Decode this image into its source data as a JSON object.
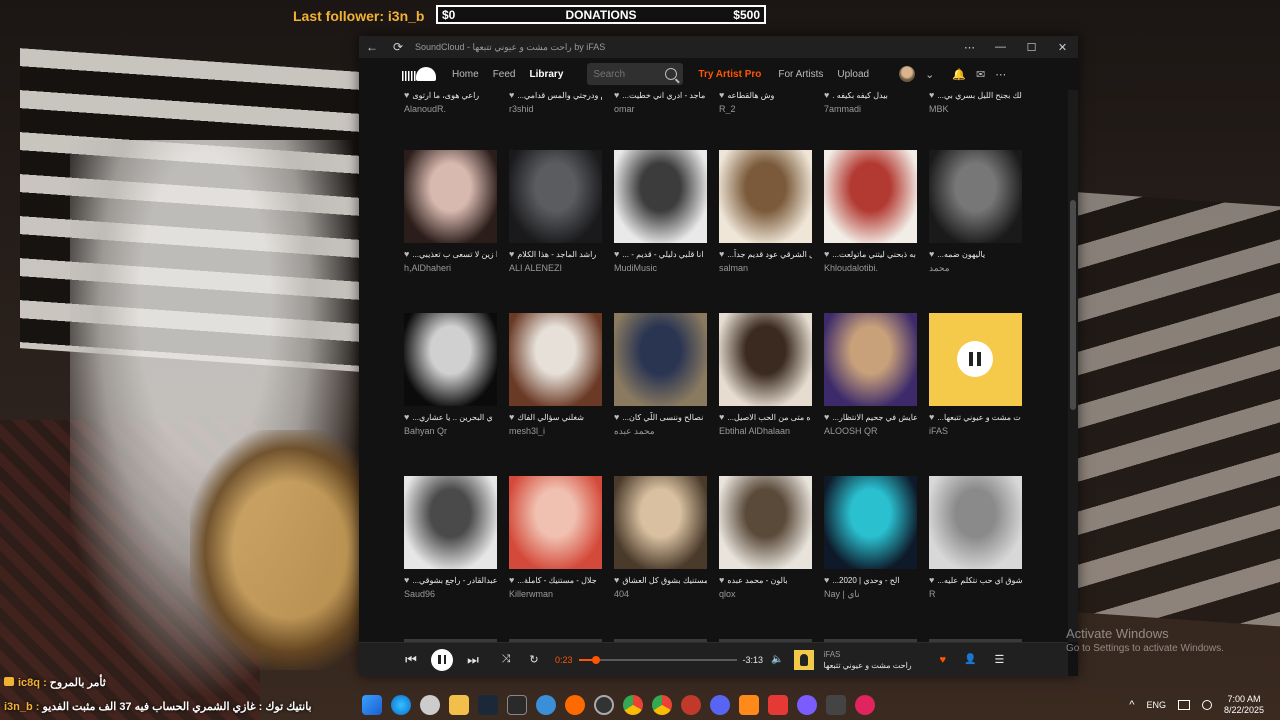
{
  "overlay": {
    "follower_label": "Last follower: i3n_b",
    "donations_min": "$0",
    "donations_title": "DONATIONS",
    "donations_max": "$500"
  },
  "window": {
    "title": "SoundCloud - راحت مشت و عيوني تتبعها by iFAS",
    "back_glyph": "←",
    "reload_glyph": "⟳",
    "more_glyph": "⋯",
    "min_glyph": "—",
    "max_glyph": "☐",
    "close_glyph": "✕"
  },
  "nav": {
    "home": "Home",
    "feed": "Feed",
    "library": "Library",
    "search_placeholder": "Search",
    "try_pro": "Try Artist Pro",
    "for_artists": "For Artists",
    "upload": "Upload",
    "chevron_glyph": "⌄",
    "bell_glyph": "🔔",
    "mail_glyph": "✉",
    "more_glyph": "⋯"
  },
  "top_row": [
    {
      "title": "راعي هوى، ما ارتوى",
      "user": "AlanoudR."
    },
    {
      "title": "...م ودرجتي والمس قدامي",
      "user": "r3shid"
    },
    {
      "title": "...ماجد - ادري اني خطيت",
      "user": "omar"
    },
    {
      "title": "وش هالقطاعه",
      "user": "R_2"
    },
    {
      "title": ". بيدل كيفه بكيفه",
      "user": "7ammadi"
    },
    {
      "title": "...لك بجنح الليل بسري بي",
      "user": "MBK"
    }
  ],
  "rows": [
    [
      {
        "title": "...ا زين لا تسعى ب تعذيبي",
        "user": "h,AlDhaheri",
        "c1": "#2b1d1a",
        "c2": "#d8b9b0"
      },
      {
        "title": "راشد الماجد - هذا الكلام",
        "user": "ALI ALENEZI",
        "c1": "#1a1a1c",
        "c2": "#5a5c60"
      },
      {
        "title": "... - انا قلبي دليلي - قديم",
        "user": "MudiMusic",
        "c1": "#e9e9e9",
        "c2": "#3c3c3c"
      },
      {
        "title": "...ل الشرقي عود قديم جداً",
        "user": "salman",
        "c1": "#efe6d8",
        "c2": "#7a5a3a"
      },
      {
        "title": "...به ذبحني ليتني ماتولعت",
        "user": "Khloudalotibi.",
        "c1": "#f2ede6",
        "c2": "#b23a32"
      },
      {
        "title": "...ياليهون ضمه",
        "user": "محمد",
        "c1": "#1a1a1a",
        "c2": "#777777"
      }
    ],
    [
      {
        "title": "...ي البحرين .. يا عشاري",
        "user": "Bahyan Qr",
        "c1": "#0b0b0b",
        "c2": "#d0d0d0"
      },
      {
        "title": "شغلني سؤالي الفاك",
        "user": "mesh3l_i",
        "c1": "#6b3a26",
        "c2": "#e6e0d8"
      },
      {
        "title": "...نصالح وننسى اللّي كان",
        "user": "محمد عبده",
        "c1": "#8a7a60",
        "c2": "#2a3552"
      },
      {
        "title": "...ه متى من الحب الاصيل",
        "user": "Ebtihal AlDhalaan",
        "c1": "#e6ddd0",
        "c2": "#3a2a20"
      },
      {
        "title": "...عايش في جحيم الانتظار",
        "user": "ALOOSH QR",
        "c1": "#3c2a6a",
        "c2": "#c8a07a"
      },
      {
        "title": "...ت مشت و عيوني تتبعها",
        "user": "iFAS",
        "c1": "#f5c94a",
        "c2": "#f5c94a"
      }
    ],
    [
      {
        "title": "...عبدالقادر - راجع بشوقي",
        "user": "Saud96",
        "c1": "#e6e6e6",
        "c2": "#4a4a4a"
      },
      {
        "title": "...جلال - مستنيك - كاملة",
        "user": "Killerwman",
        "c1": "#d44a3a",
        "c2": "#f0c0b0"
      },
      {
        "title": "مستنيك بشوق كل العشاق",
        "user": "404",
        "c1": "#4a3a2a",
        "c2": "#d8c0a0"
      },
      {
        "title": "بالون - محمد عبده",
        "user": "qlox",
        "c1": "#e8e4dc",
        "c2": "#5a4a3a"
      },
      {
        "title": "...الح - وحدي | 2020",
        "user": "Nay | ناي",
        "c1": "#0e1a2a",
        "c2": "#2ac0d0"
      },
      {
        "title": "...شوق اي حب نتكلم عليه",
        "user": "R",
        "c1": "#d8d8d8",
        "c2": "#8a8a8a"
      }
    ]
  ],
  "player": {
    "prev_glyph": "⏮",
    "next_glyph": "⏭",
    "shuffle_glyph": "⤨",
    "repeat_glyph": "↻",
    "elapsed": "0:23",
    "remaining": "-3:13",
    "progress_fraction": 0.11,
    "volume_glyph": "🔈",
    "np_user": "iFAS",
    "np_title": "راحت مشت و عيوني تتبعها",
    "like_glyph": "♥",
    "follow_glyph": "👤",
    "queue_glyph": "☰"
  },
  "watermark": {
    "line1": "Activate Windows",
    "line2": "Go to Settings to activate Windows."
  },
  "chat": [
    {
      "name": "ic8q :",
      "text": " ثأمر بالمروح"
    },
    {
      "name": "i3n_b :",
      "text": " بانتيك توك : غازي الشمري الحساب فيه 37 الف مثبت الفديو"
    }
  ],
  "tray": {
    "chevron_glyph": "^",
    "lang": "ENG",
    "time": "7:00 AM",
    "date": "8/22/2025"
  },
  "colors": {
    "accent": "#ff5500",
    "overlay_gold": "#f2b233"
  }
}
